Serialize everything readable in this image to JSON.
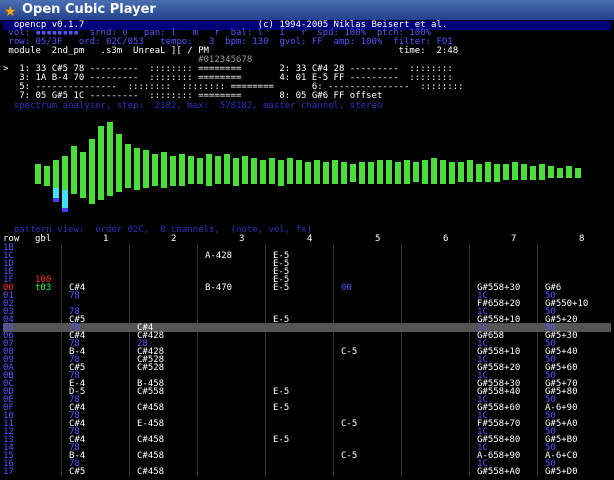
{
  "window": {
    "title": "Open Cubic Player"
  },
  "header": {
    "line0": "  opencp v0.1.7                                (c) 1994-2005 Niklas Beisert et al.",
    "line1": " vol: ▪▪▪▪▪▪▪▪  srnd: o   pan: l   m   r  bal: l   I   r  spd: 100%  ptch: 100%",
    "line2": " row: 05/3F   ord: 02C/053   tempo:   3  bpm: 130  gvol: FF  amp: 100%  filter: FOI",
    "line3": " module  2nd_pm   .s3m  UnreaL ][ / PM                                   time:  2:48"
  },
  "channels": {
    "ruler": "                                    #012345678",
    "rows": [
      ">  1: 33 C#5 78 ---------  :::::::: ========       2: 33 C#4 28 ---------  ::::::::",
      "   3: 1A B-4 70 ---------  :::::::: ========       4: 01 E-5 FF ---------  ::::::::",
      "   5: ---------------  ::::::::  :::::::: ========       6: ---------------  ::::::::",
      "   7: 05 G#5 1C ---------  :::::::: ========       8: 05 G#6 FF offset"
    ]
  },
  "spectrum": {
    "label": "  spectrum analyser, step:  2182, max:  578182, master channel, stereo",
    "bars_top": [
      10,
      8,
      14,
      18,
      28,
      22,
      35,
      48,
      52,
      40,
      30,
      26,
      24,
      20,
      22,
      18,
      20,
      18,
      16,
      20,
      18,
      20,
      16,
      18,
      16,
      14,
      16,
      14,
      16,
      14,
      12,
      14,
      12,
      14,
      12,
      10,
      12,
      12,
      14,
      14,
      12,
      14,
      12,
      14,
      16,
      14,
      12,
      12,
      14,
      10,
      12,
      10,
      10,
      12,
      10,
      8,
      10,
      8,
      6,
      8,
      6
    ],
    "bars_bot": [
      10,
      12,
      14,
      16,
      20,
      24,
      30,
      26,
      22,
      18,
      14,
      16,
      14,
      12,
      14,
      12,
      12,
      10,
      10,
      12,
      10,
      10,
      12,
      10,
      10,
      10,
      10,
      12,
      10,
      10,
      10,
      10,
      10,
      10,
      10,
      8,
      10,
      10,
      10,
      10,
      10,
      10,
      8,
      10,
      10,
      10,
      10,
      8,
      8,
      8,
      8,
      8,
      6,
      6,
      6,
      6,
      6,
      4,
      4,
      4,
      4
    ],
    "peak_bars": [
      [
        2,
        5
      ],
      [
        3,
        9
      ]
    ]
  },
  "pattern": {
    "label": "  pattern view:  order 02C,  8 channels,  (note, vol, fx)",
    "colheads": [
      "row",
      "gbl",
      "1",
      "2",
      "3",
      "4",
      "5",
      "6",
      "7",
      "8"
    ],
    "rows": [
      [
        "1B",
        "",
        "",
        "",
        "",
        "",
        "",
        "",
        "",
        ""
      ],
      [
        "1C",
        "",
        "",
        "",
        "A-428",
        "E-5",
        "",
        "",
        "",
        ""
      ],
      [
        "1D",
        "",
        "",
        "",
        "",
        "E-5",
        "",
        "",
        "",
        ""
      ],
      [
        "1E",
        "",
        "",
        "",
        "",
        "E-5",
        "",
        "",
        "",
        ""
      ],
      [
        "1F",
        "100",
        "",
        "",
        "",
        "E-5",
        "",
        "",
        "",
        ""
      ],
      [
        "00",
        "t03",
        "C#4",
        "",
        "B-470",
        "E-5",
        "00",
        "",
        "G#558+30",
        "G#6"
      ],
      [
        "01",
        "",
        "78",
        "",
        "",
        "",
        "",
        "",
        "1C",
        "50"
      ],
      [
        "02",
        "",
        "",
        "",
        "",
        "",
        "",
        "",
        "F#658+20",
        "G#550+10"
      ],
      [
        "03",
        "",
        "78",
        "",
        "",
        "",
        "",
        "",
        "1C",
        "50"
      ],
      [
        "04",
        "",
        "C#5",
        "",
        "",
        "E-5",
        "",
        "",
        "G#558+10",
        "G#5+20"
      ],
      [
        "05",
        "",
        "78",
        "C#4",
        "",
        "",
        "",
        "",
        "1C",
        "50"
      ],
      [
        "06",
        "",
        "C#4",
        "C#428",
        "",
        "",
        "",
        "",
        "G#658",
        "G#5+30"
      ],
      [
        "07",
        "",
        "78",
        "28",
        "",
        "",
        "",
        "",
        "1C",
        "50"
      ],
      [
        "08",
        "",
        "B-4",
        "C#428",
        "",
        "",
        "C-5",
        "",
        "G#558+10",
        "G#5+40"
      ],
      [
        "09",
        "",
        "78",
        "C#528",
        "",
        "",
        "",
        "",
        "1C",
        "50"
      ],
      [
        "0A",
        "",
        "C#5",
        "C#528",
        "",
        "",
        "",
        "",
        "G#558+20",
        "G#5+60"
      ],
      [
        "0B",
        "",
        "78",
        "",
        "",
        "",
        "",
        "",
        "1C",
        "50"
      ],
      [
        "0C",
        "",
        "E-4",
        "B-458",
        "",
        "",
        "",
        "",
        "G#558+30",
        "G#5+70"
      ],
      [
        "0D",
        "",
        "D-5",
        "C#558",
        "",
        "E-5",
        "",
        "",
        "G#558+40",
        "G#5+80"
      ],
      [
        "0E",
        "",
        "78",
        "",
        "",
        "",
        "",
        "",
        "1C",
        "50"
      ],
      [
        "0F",
        "",
        "C#4",
        "C#458",
        "",
        "E-5",
        "",
        "",
        "G#558+60",
        "A-6+90"
      ],
      [
        "10",
        "",
        "78",
        "",
        "",
        "",
        "",
        "",
        "1C",
        "50"
      ],
      [
        "11",
        "",
        "C#4",
        "E-458",
        "",
        "",
        "C-5",
        "",
        "F#558+70",
        "G#5+A0"
      ],
      [
        "12",
        "",
        "78",
        "",
        "",
        "",
        "",
        "",
        "1C",
        "50"
      ],
      [
        "13",
        "",
        "C#4",
        "C#458",
        "",
        "E-5",
        "",
        "",
        "G#558+80",
        "G#5+B0"
      ],
      [
        "14",
        "",
        "78",
        "",
        "",
        "",
        "",
        "",
        "1C",
        "50"
      ],
      [
        "15",
        "",
        "B-4",
        "C#458",
        "",
        "",
        "C-5",
        "",
        "A-658+90",
        "A-6+C0"
      ],
      [
        "16",
        "",
        "78",
        "",
        "",
        "",
        "",
        "",
        "1C",
        "50"
      ],
      [
        "17",
        "",
        "C#5",
        "C#458",
        "",
        "",
        "",
        "",
        "G#558+A0",
        "G#5+D0"
      ]
    ]
  }
}
